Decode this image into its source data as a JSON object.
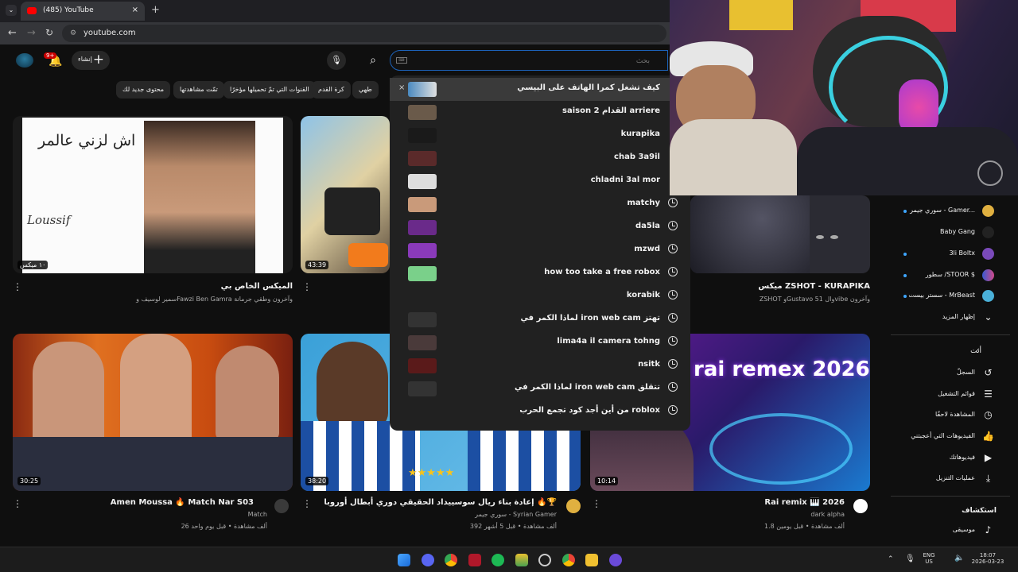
{
  "browser": {
    "tab_title": "(485) YouTube",
    "tab_close": "×",
    "new_tab": "+",
    "url": "youtube.com"
  },
  "header": {
    "notification_count": "9+",
    "create_label": "إنشاء",
    "search_value": "بحث"
  },
  "chips": [
    "محتوى جديد لك",
    "تمّت مشاهدتها",
    "القنوات التي تمّ تحميلها مؤخرًا",
    "كرة القدم",
    "طهي"
  ],
  "suggestions": [
    {
      "text": "كيف تشغل كمرا الهاتف على البيسي",
      "history": false,
      "remove": "×",
      "active": true
    },
    {
      "text": "saison 2 القدام arriere",
      "history": false
    },
    {
      "text": "kurapika",
      "history": false
    },
    {
      "text": "chab 3a9il",
      "history": false
    },
    {
      "text": "chladni 3al mor",
      "history": false
    },
    {
      "text": "matchy",
      "history": true
    },
    {
      "text": "da5la",
      "history": true
    },
    {
      "text": "mzwd",
      "history": true
    },
    {
      "text": "how too take a free robox",
      "history": true
    },
    {
      "text": "korabik",
      "history": true
    },
    {
      "text": "لماذا الكمر في iron web cam تهتز",
      "history": true
    },
    {
      "text": "lima4a il camera tohng",
      "history": true
    },
    {
      "text": "nsitk",
      "history": true
    },
    {
      "text": "لماذا الكمر في iron web cam تتقلق",
      "history": true
    },
    {
      "text": "من أين أجد كود تجمع الحرب roblox",
      "history": true
    }
  ],
  "videos": [
    {
      "title": "الميكس الخاص بي",
      "meta": "سمير لوسيف وFawzi Ben Gamra وآخرون وطقي جرمانة",
      "duration": "١٠ ميكس",
      "thumb_text": "اش لزني عالمر",
      "thumb_text2": "Loussif"
    },
    {
      "title": "ميكس ZSHOT - KURAPIKA",
      "meta": "ZSHOT وGustavo 51 والvibe وآخرون",
      "duration": "43:39"
    },
    {
      "title": "Amen Moussa 🔥 Match Nar S03",
      "channel": "Match",
      "meta": "26 ألف مشاهدة • قبل يوم واحد",
      "duration": "30:25"
    },
    {
      "title": "إعادة بناء ريال سوسييداد الحقيقي دوري أبطال أوروبا 🔥🏆",
      "channel": "سوري جيمر - Syrian Gamer",
      "meta": "392 ألف مشاهدة • قبل 5 أشهر",
      "duration": "38:20"
    },
    {
      "title": "Rai remix 🎹 2026",
      "channel": "dark alpha",
      "meta": "1.8 ألف مشاهدة • قبل يومين",
      "duration": "10:14",
      "thumb_text": "rai remex 2026"
    }
  ],
  "sidebar": {
    "subscriptions": [
      {
        "label": "سوري جيمر - Gamer...",
        "dot": true
      },
      {
        "label": "Baby Gang",
        "dot": false
      },
      {
        "label": "3li Boltx",
        "dot": true
      },
      {
        "label": "سطور /STOOR $",
        "dot": true
      },
      {
        "label": "سستر بيست - MrBeast",
        "dot": true
      }
    ],
    "show_more": "إظهار المزيد",
    "you_heading": "أنت",
    "you_items": [
      {
        "label": "السجلّ",
        "icon": "history-icon"
      },
      {
        "label": "قوائم التشغيل",
        "icon": "playlist-icon"
      },
      {
        "label": "المشاهدة لاحقًا",
        "icon": "clock-icon"
      },
      {
        "label": "الفيديوهات التي أعجبتني",
        "icon": "like-icon"
      },
      {
        "label": "فيديوهاتك",
        "icon": "video-icon"
      },
      {
        "label": "عمليات التنزيل",
        "icon": "download-icon"
      }
    ],
    "explore_heading": "استكشاف",
    "music_label": "موسيقى"
  },
  "taskbar": {
    "lang1": "ENG",
    "lang2": "US",
    "time": "18:07",
    "date": "2026-03-23"
  },
  "colors": {
    "accent": "#3ea6ff",
    "search_border": "#1c62b9",
    "background": "#0f0f0f",
    "dropdown": "#212121"
  }
}
